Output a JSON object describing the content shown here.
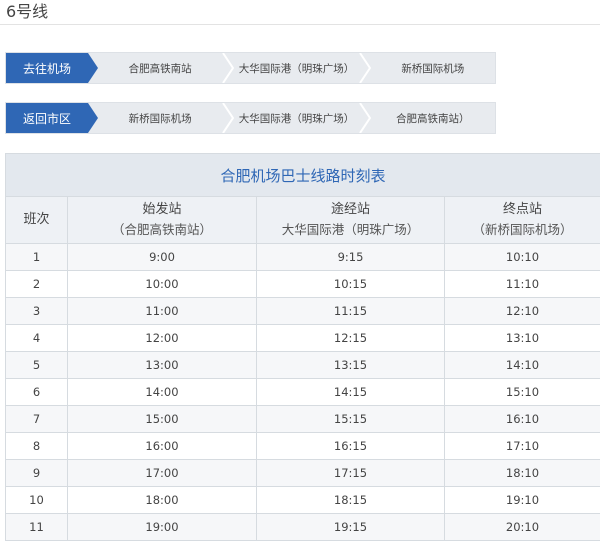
{
  "page": {
    "title": "6号线"
  },
  "routes": {
    "to_airport": {
      "tag": "去往机场",
      "stops": [
        "合肥高铁南站",
        "大华国际港（明珠广场）",
        "新桥国际机场"
      ]
    },
    "to_city": {
      "tag": "返回市区",
      "stops": [
        "新桥国际机场",
        "大华国际港（明珠广场）",
        "合肥高铁南站）"
      ]
    }
  },
  "timetable": {
    "caption": "合肥机场巴士线路时刻表",
    "headers": {
      "index": "班次",
      "origin": "始发站",
      "origin_sub": "（合肥高铁南站）",
      "via": "途经站",
      "via_sub": "大华国际港（明珠广场）",
      "terminal": "终点站",
      "terminal_sub": "（新桥国际机场）"
    },
    "rows": [
      {
        "n": "1",
        "origin": "9:00",
        "via": "9:15",
        "terminal": "10:10"
      },
      {
        "n": "2",
        "origin": "10:00",
        "via": "10:15",
        "terminal": "11:10"
      },
      {
        "n": "3",
        "origin": "11:00",
        "via": "11:15",
        "terminal": "12:10"
      },
      {
        "n": "4",
        "origin": "12:00",
        "via": "12:15",
        "terminal": "13:10"
      },
      {
        "n": "5",
        "origin": "13:00",
        "via": "13:15",
        "terminal": "14:10"
      },
      {
        "n": "6",
        "origin": "14:00",
        "via": "14:15",
        "terminal": "15:10"
      },
      {
        "n": "7",
        "origin": "15:00",
        "via": "15:15",
        "terminal": "16:10"
      },
      {
        "n": "8",
        "origin": "16:00",
        "via": "16:15",
        "terminal": "17:10"
      },
      {
        "n": "9",
        "origin": "17:00",
        "via": "17:15",
        "terminal": "18:10"
      },
      {
        "n": "10",
        "origin": "18:00",
        "via": "18:15",
        "terminal": "19:10"
      },
      {
        "n": "11",
        "origin": "19:00",
        "via": "19:15",
        "terminal": "20:10"
      }
    ]
  }
}
